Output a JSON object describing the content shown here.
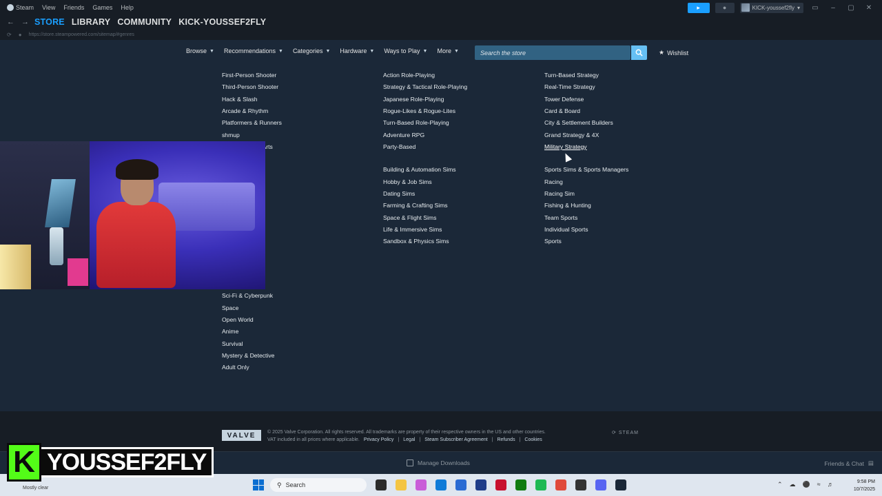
{
  "titlebar": {
    "menu": [
      "Steam",
      "View",
      "Friends",
      "Games",
      "Help"
    ],
    "username": "KICK-youssef2fly"
  },
  "nav": {
    "tabs": [
      "STORE",
      "LIBRARY",
      "COMMUNITY",
      "KICK-YOUSSEF2FLY"
    ],
    "active_tab": "STORE",
    "url": "https://store.steampowered.com/sitemap/#genres"
  },
  "store_nav": {
    "items": [
      "Browse",
      "Recommendations",
      "Categories",
      "Hardware",
      "Ways to Play",
      "More"
    ],
    "search_placeholder": "Search the store",
    "wishlist": "Wishlist"
  },
  "genres": {
    "col1_top": [
      "First-Person Shooter",
      "Third-Person Shooter",
      "Hack & Slash",
      "Arcade & Rhythm",
      "Platformers & Runners",
      "shmup"
    ],
    "col1_partial": "ial Arts",
    "col1_bottom": [
      "Sci-Fi & Cyberpunk",
      "Space",
      "Open World",
      "Anime",
      "Survival",
      "Mystery & Detective",
      "Adult Only"
    ],
    "col2_top": [
      "Action Role-Playing",
      "Strategy & Tactical Role-Playing",
      "Japanese Role-Playing",
      "Rogue-Likes & Rogue-Lites",
      "Turn-Based Role-Playing",
      "Adventure RPG",
      "Party-Based"
    ],
    "col2_bottom": [
      "Building & Automation Sims",
      "Hobby & Job Sims",
      "Dating Sims",
      "Farming & Crafting Sims",
      "Space & Flight Sims",
      "Life & Immersive Sims",
      "Sandbox & Physics Sims"
    ],
    "col3_top": [
      "Turn-Based Strategy",
      "Real-Time Strategy",
      "Tower Defense",
      "Card & Board",
      "City & Settlement Builders",
      "Grand Strategy & 4X",
      "Military Strategy"
    ],
    "col3_bottom": [
      "Sports Sims & Sports Managers",
      "Racing",
      "Racing Sim",
      "Fishing & Hunting",
      "Team Sports",
      "Individual Sports",
      "Sports"
    ]
  },
  "footer": {
    "valve": "VALVE",
    "copyright": "© 2025 Valve Corporation. All rights reserved. All trademarks are property of their respective owners in the US and other countries.",
    "vat": "VAT included in all prices where applicable.",
    "links": [
      "Privacy Policy",
      "Legal",
      "Steam Subscriber Agreement",
      "Refunds",
      "Cookies"
    ],
    "steam_mark": "STEAM"
  },
  "bottombar": {
    "manage_downloads": "Manage Downloads",
    "friends_chat": "Friends & Chat"
  },
  "taskbar": {
    "weather": "Mostly clear",
    "search": "Search",
    "time": "9:58 PM",
    "date": "10/7/2025"
  },
  "overlay": {
    "k": "K",
    "name": "YOUSSEF2FLY"
  },
  "colors": {
    "accent": "#1a9fff",
    "bg": "#1b2838",
    "dark": "#171d25",
    "kick_green": "#53fc18"
  }
}
